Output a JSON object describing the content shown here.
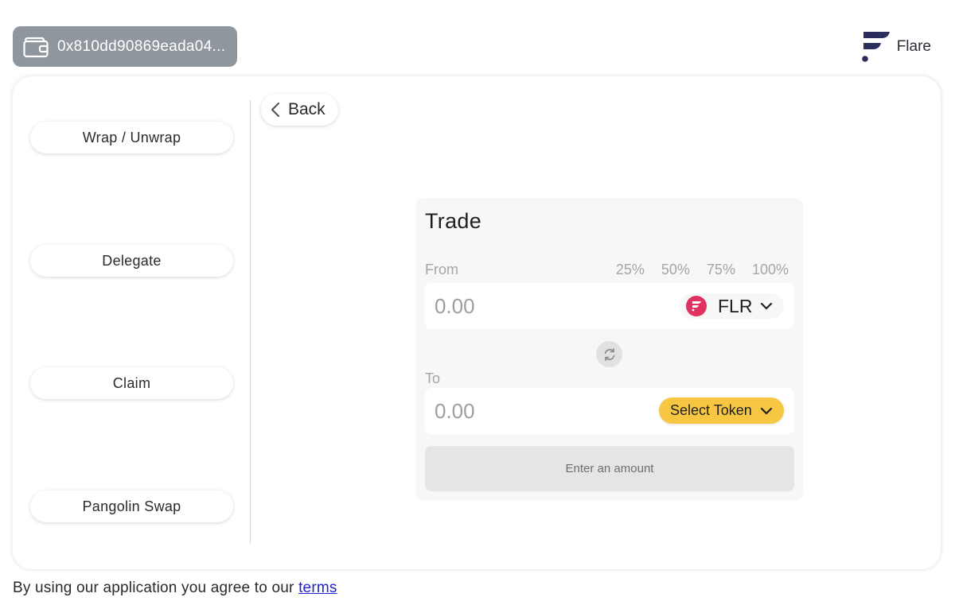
{
  "header": {
    "wallet_address": "0x810dd90869eada04...",
    "brand_name": "Flare"
  },
  "sidebar": {
    "items": [
      {
        "label": "Wrap / Unwrap"
      },
      {
        "label": "Delegate"
      },
      {
        "label": "Claim"
      },
      {
        "label": "Pangolin Swap"
      }
    ]
  },
  "nav": {
    "back_label": "Back"
  },
  "trade": {
    "title": "Trade",
    "from_label": "From",
    "to_label": "To",
    "percent_options": [
      "25%",
      "50%",
      "75%",
      "100%"
    ],
    "from_amount_placeholder": "0.00",
    "to_amount_placeholder": "0.00",
    "from_token": "FLR",
    "to_token_label": "Select Token",
    "submit_label": "Enter an amount"
  },
  "footer": {
    "text": "By using our application you agree to our ",
    "link_text": "terms"
  },
  "colors": {
    "wallet_bg": "#8f969e",
    "brand_navy": "#2b2d5c",
    "flr_red": "#e0325f",
    "select_token_yellow": "#f7c744",
    "link_blue": "#2222cc"
  },
  "icons": {
    "wallet": "wallet-icon",
    "brand": "flare-logo",
    "back": "chevron-left-icon",
    "dropdown": "chevron-down-icon",
    "swap": "refresh-icon"
  }
}
